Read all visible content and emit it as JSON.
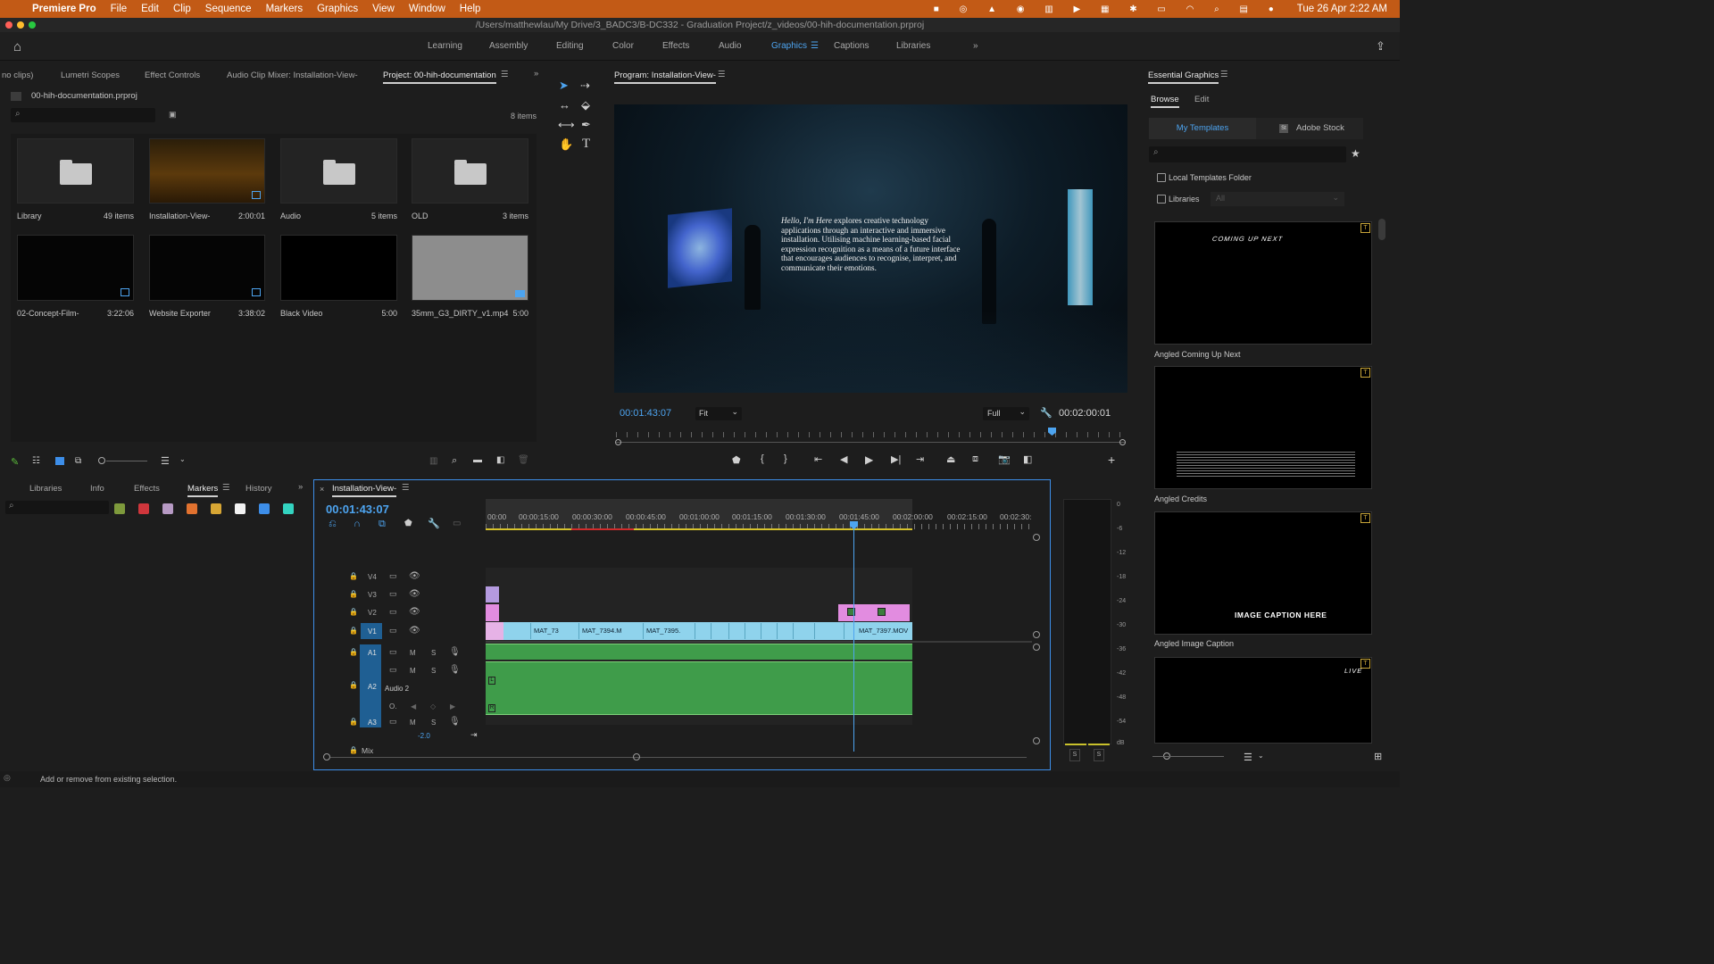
{
  "menubar": {
    "app": "Premiere Pro",
    "items": [
      "File",
      "Edit",
      "Clip",
      "Sequence",
      "Markers",
      "Graphics",
      "View",
      "Window",
      "Help"
    ],
    "datetime": "Tue 26 Apr  2:22 AM"
  },
  "titlebar": {
    "path": "/Users/matthewlau/My Drive/3_BADC3/B-DC332 - Graduation Project/z_videos/00-hih-documentation.prproj"
  },
  "workspaces": {
    "tabs": [
      "Learning",
      "Assembly",
      "Editing",
      "Color",
      "Effects",
      "Audio",
      "Graphics",
      "Captions",
      "Libraries"
    ],
    "active": "Graphics"
  },
  "project_panel": {
    "tabs": [
      "no clips)",
      "Lumetri Scopes",
      "Effect Controls",
      "Audio Clip Mixer: Installation-View-",
      "Project: 00-hih-documentation"
    ],
    "file": "00-hih-documentation.prproj",
    "count": "8 items",
    "items": [
      {
        "name": "Library",
        "meta": "49 items"
      },
      {
        "name": "Installation-View-",
        "meta": "2:00:01"
      },
      {
        "name": "Audio",
        "meta": "5 items"
      },
      {
        "name": "OLD",
        "meta": "3 items"
      },
      {
        "name": "02-Concept-Film-",
        "meta": "3:22:06"
      },
      {
        "name": "Website Exporter",
        "meta": "3:38:02"
      },
      {
        "name": "Black Video",
        "meta": "5:00"
      },
      {
        "name": "35mm_G3_DIRTY_v1.mp4",
        "meta": "5:00"
      }
    ]
  },
  "program": {
    "title": "Program: Installation-View-",
    "caption_italic": "Hello, I'm Here",
    "caption_rest": " explores creative technology applications through an interactive and immersive installation. Utilising machine learning-based facial expression recognition as a means of a future interface that encourages audiences to recognise, interpret, and communicate their emotions.",
    "timecode": "00:01:43:07",
    "fit": "Fit",
    "quality": "Full",
    "duration": "00:02:00:01"
  },
  "markers_panel": {
    "tabs": [
      "Libraries",
      "Info",
      "Effects",
      "Markers",
      "History"
    ],
    "active": "Markers",
    "swatches": [
      "#7e9a3c",
      "#d0363c",
      "#b79ac4",
      "#e2722f",
      "#d7a634",
      "#f2f2f2",
      "#3d8ee9",
      "#33d3c0"
    ]
  },
  "timeline": {
    "tab": "Installation-View-",
    "timecode": "00:01:43:07",
    "ticks": [
      "00:00",
      "00:00:15:00",
      "00:00:30:00",
      "00:00:45:00",
      "00:01:00:00",
      "00:01:15:00",
      "00:01:30:00",
      "00:01:45:00",
      "00:02:00:00",
      "00:02:15:00",
      "00:02:30:"
    ],
    "tracks": {
      "video": [
        "V4",
        "V3",
        "V2",
        "V1"
      ],
      "audio": [
        "A1",
        "A2",
        "A3"
      ],
      "audio2_name": "Audio 2",
      "mix": "Mix",
      "mix_value": "-2.0"
    },
    "clips": [
      "MAT_73",
      "MAT_7394.M",
      "MAT_7395.",
      "MAT_7397.MOV"
    ]
  },
  "meter": {
    "labels": [
      "0",
      "-6",
      "-12",
      "-18",
      "-24",
      "-30",
      "-36",
      "-42",
      "-48",
      "-54",
      "dB"
    ],
    "solo": [
      "S",
      "S"
    ]
  },
  "essential_graphics": {
    "title": "Essential Graphics",
    "tabs": [
      "Browse",
      "Edit"
    ],
    "subtabs": [
      "My Templates",
      "Adobe Stock"
    ],
    "checkbox_local": "Local Templates Folder",
    "checkbox_libraries": "Libraries",
    "libraries_select": "All",
    "templates": [
      {
        "name": "Angled Coming Up Next",
        "overlay": "COMING UP NEXT"
      },
      {
        "name": "Angled Credits",
        "overlay": ""
      },
      {
        "name": "Angled Image Caption",
        "overlay": "IMAGE CAPTION HERE"
      },
      {
        "name": "",
        "overlay": "LIVE"
      }
    ]
  },
  "status": {
    "text": "Add or remove from existing selection."
  }
}
